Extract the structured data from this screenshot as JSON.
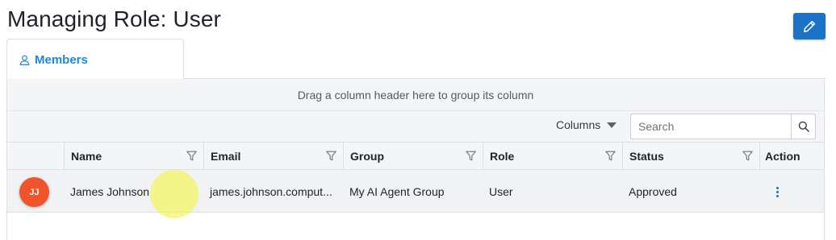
{
  "page": {
    "title": "Managing Role: User"
  },
  "header": {
    "edit_icon": "pencil-icon",
    "accent": "#1a73c8"
  },
  "tabs": [
    {
      "label": "Members",
      "icon": "user-icon",
      "active": true
    }
  ],
  "grid": {
    "group_hint": "Drag a column header here to group its column",
    "toolbar": {
      "columns_label": "Columns",
      "search_placeholder": "Search",
      "search_value": ""
    },
    "columns": [
      "Name",
      "Email",
      "Group",
      "Role",
      "Status",
      "Action"
    ],
    "rows": [
      {
        "avatar": {
          "initials": "JJ",
          "color": "#f1542a"
        },
        "name": "James Johnson",
        "email": "james.johnson.comput...",
        "group": "My AI Agent Group",
        "role": "User",
        "status": "Approved",
        "action_icon": "kebab-menu-icon"
      }
    ]
  }
}
